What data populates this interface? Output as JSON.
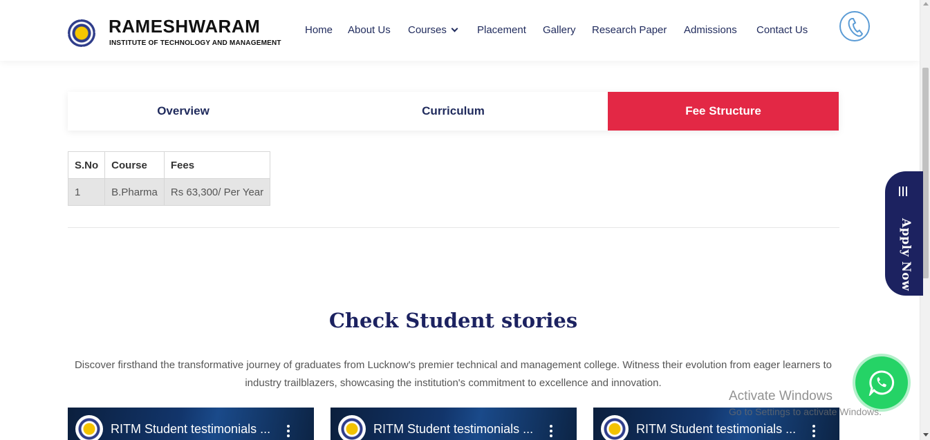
{
  "brand": {
    "title": "RAMESHWARAM",
    "subtitle": "INSTITUTE OF TECHNOLOGY AND MANAGEMENT"
  },
  "nav": {
    "items": [
      {
        "label": "Home"
      },
      {
        "label": "About Us"
      },
      {
        "label": "Courses"
      },
      {
        "label": "Placement"
      },
      {
        "label": "Gallery"
      },
      {
        "label": "Research Paper"
      },
      {
        "label": "Admissions"
      },
      {
        "label": "Contact Us"
      }
    ]
  },
  "tabs": {
    "items": [
      {
        "label": "Overview"
      },
      {
        "label": "Curriculum"
      },
      {
        "label": "Fee Structure"
      }
    ],
    "active": "Fee Structure"
  },
  "fee_table": {
    "headers": [
      "S.No",
      "Course",
      "Fees"
    ],
    "rows": [
      [
        "1",
        "B.Pharma",
        "Rs 63,300/ Per Year"
      ]
    ]
  },
  "apply": {
    "label": "Apply Now"
  },
  "stories": {
    "title": "Check Student stories",
    "description": "Discover firsthand the transformative journey of graduates from Lucknow's premier technical and management college. Witness their evolution from eager learners to industry trailblazers, showcasing the institution's commitment to excellence and innovation."
  },
  "videos": [
    {
      "title": "RITM Student testimonials ..."
    },
    {
      "title": "RITM Student testimonials ..."
    },
    {
      "title": "RITM Student testimonials ..."
    }
  ],
  "watermark": {
    "title": "Activate Windows",
    "subtitle": "Go to Settings to activate Windows."
  },
  "colors": {
    "brand_navy": "#1c2260",
    "active_tab": "#e32845",
    "whatsapp": "#25d366"
  }
}
